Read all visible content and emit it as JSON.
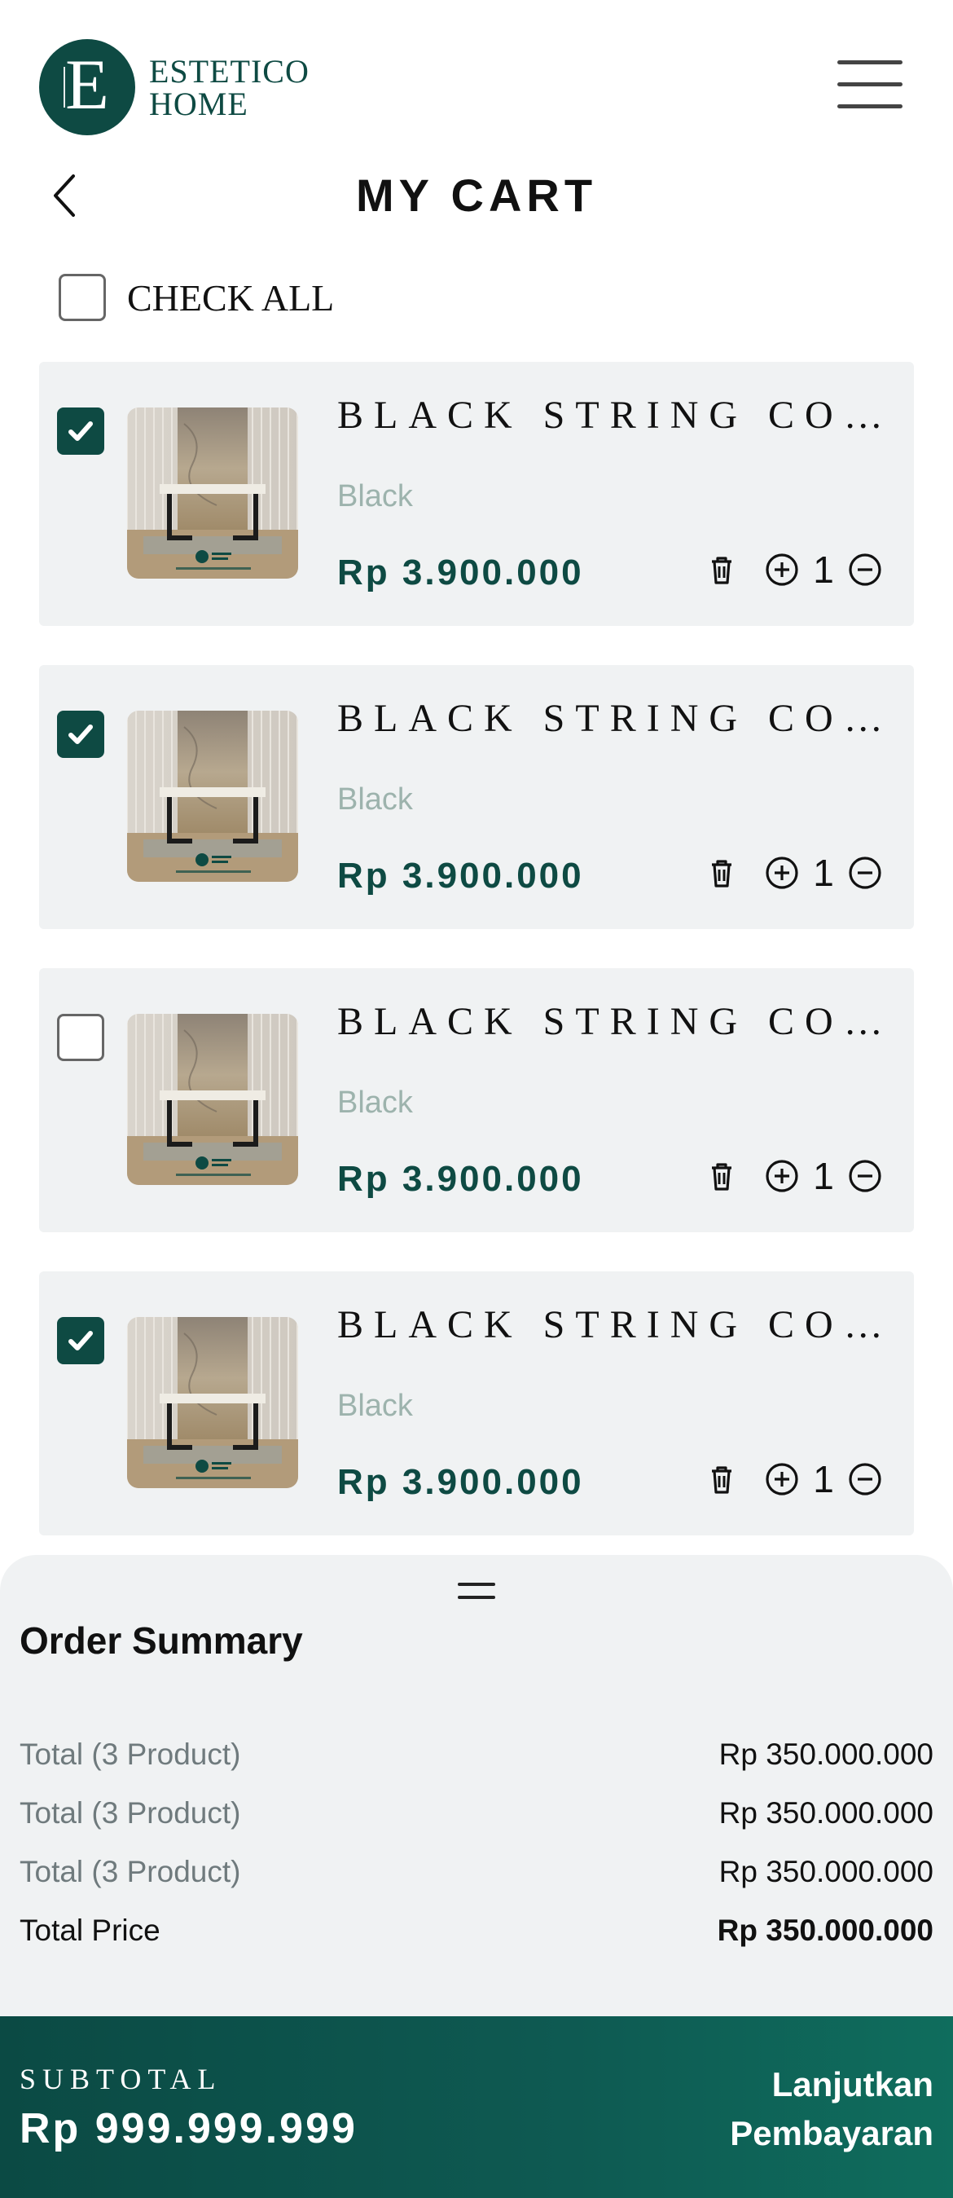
{
  "brand": {
    "logo_letter": "E",
    "line1": "ESTETICO",
    "line2": "HOME",
    "color": "#0e4a43"
  },
  "page": {
    "title": "MY CART"
  },
  "check_all": {
    "label": "CHECK ALL",
    "checked": false
  },
  "items": [
    {
      "name": "BLACK STRING COUNTER TABLE",
      "variant": "Black",
      "price": "Rp 3.900.000",
      "qty": "1",
      "checked": true
    },
    {
      "name": "BLACK STRING COUNTER TABLE",
      "variant": "Black",
      "price": "Rp 3.900.000",
      "qty": "1",
      "checked": true
    },
    {
      "name": "BLACK STRING COUNTER TABLE",
      "variant": "Black",
      "price": "Rp 3.900.000",
      "qty": "1",
      "checked": false
    },
    {
      "name": "BLACK STRING COUNTER TABLE",
      "variant": "Black",
      "price": "Rp 3.900.000",
      "qty": "1",
      "checked": true
    }
  ],
  "summary": {
    "title": "Order Summary",
    "rows": [
      {
        "label": "Total (3 Product)",
        "value": "Rp 350.000.000"
      },
      {
        "label": "Total (3 Product)",
        "value": "Rp 350.000.000"
      },
      {
        "label": "Total (3 Product)",
        "value": "Rp 350.000.000"
      }
    ],
    "total": {
      "label": "Total Price",
      "value": "Rp 350.000.000"
    }
  },
  "footer": {
    "subtotal_label": "SUBTOTAL",
    "subtotal_value": "Rp 999.999.999",
    "cta_line1": "Lanjutkan",
    "cta_line2": "Pembayaran"
  },
  "icons": {
    "menu": "hamburger-icon",
    "back": "chevron-left-icon",
    "checkbox": "check-icon",
    "delete": "trash-icon",
    "increase": "plus-circle-icon",
    "decrease": "minus-circle-icon"
  }
}
